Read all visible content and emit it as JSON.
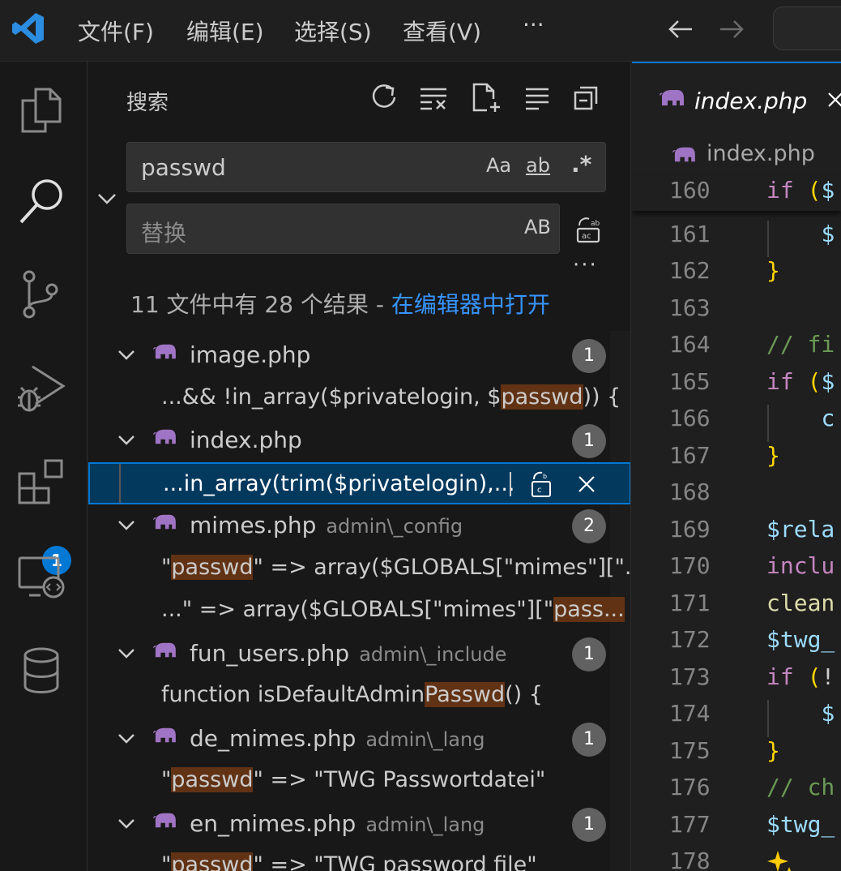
{
  "menu": {
    "file": "文件(F)",
    "edit": "编辑(E)",
    "selection": "选择(S)",
    "view": "查看(V)",
    "more": "···"
  },
  "activity_bar": {
    "icons": [
      "explorer-icon",
      "search-icon",
      "source-control-icon",
      "run-debug-icon",
      "extensions-icon",
      "remote-explorer-icon",
      "database-icon"
    ],
    "extensions_badge": "1",
    "accent": "#0078d4"
  },
  "search_view": {
    "title": "搜索",
    "search": {
      "value": "passwd",
      "match_case": "Aa",
      "whole_word": "ab",
      "regex": ".*"
    },
    "replace": {
      "placeholder": "替换",
      "preserve_case": "AB"
    },
    "more": "···",
    "summary": "11 文件中有 28 个结果 - ",
    "summary_link": "在编辑器中打开",
    "results": [
      {
        "file": "image.php",
        "path": "",
        "count": "1",
        "matches": [
          {
            "pre": "...&& !in_array($privatelogin, $",
            "hl": "passwd",
            "post": ")) {"
          }
        ]
      },
      {
        "file": "index.php",
        "path": "",
        "count": "1",
        "matches": [
          {
            "pre": "...in_array(trim($privatelogin),...",
            "hl": "",
            "post": ""
          }
        ]
      },
      {
        "file": "mimes.php",
        "path": "admin\\_config",
        "count": "2",
        "matches": [
          {
            "pre": "\"",
            "hl": "passwd",
            "post": "\" => array($GLOBALS[\"mimes\"][\"..."
          },
          {
            "pre": "...\"    => array($GLOBALS[\"mimes\"][\"",
            "hl": "pass...",
            "post": ""
          }
        ]
      },
      {
        "file": "fun_users.php",
        "path": "admin\\_include",
        "count": "1",
        "matches": [
          {
            "pre": "function isDefaultAdmin",
            "hl": "Passwd",
            "post": "() {"
          }
        ]
      },
      {
        "file": "de_mimes.php",
        "path": "admin\\_lang",
        "count": "1",
        "matches": [
          {
            "pre": "\"",
            "hl": "passwd",
            "post": "\" => \"TWG Passwortdatei\""
          }
        ]
      },
      {
        "file": "en_mimes.php",
        "path": "admin\\_lang",
        "count": "1",
        "matches": [
          {
            "pre": "\"",
            "hl": "passwd",
            "post": "\" => \"TWG password file\""
          }
        ]
      }
    ]
  },
  "editor": {
    "tab_label": "index.php",
    "breadcrumb": "index.php",
    "lines": [
      {
        "n": "160",
        "parts": [
          [
            "kw",
            "if"
          ],
          [
            "pl",
            " "
          ],
          [
            "br1",
            "("
          ],
          [
            "var",
            "$"
          ]
        ]
      },
      {
        "n": "161",
        "parts": [
          [
            "pl",
            "    "
          ],
          [
            "var",
            "$"
          ]
        ]
      },
      {
        "n": "162",
        "parts": [
          [
            "br1",
            "}"
          ]
        ]
      },
      {
        "n": "163",
        "parts": []
      },
      {
        "n": "164",
        "parts": [
          [
            "cmt",
            "// fi"
          ]
        ]
      },
      {
        "n": "165",
        "parts": [
          [
            "kw",
            "if"
          ],
          [
            "pl",
            " "
          ],
          [
            "br1",
            "("
          ],
          [
            "var",
            "$"
          ]
        ]
      },
      {
        "n": "166",
        "parts": [
          [
            "pl",
            "    "
          ],
          [
            "var",
            "c"
          ]
        ]
      },
      {
        "n": "167",
        "parts": [
          [
            "br1",
            "}"
          ]
        ]
      },
      {
        "n": "168",
        "parts": []
      },
      {
        "n": "169",
        "parts": [
          [
            "var",
            "$rela"
          ]
        ]
      },
      {
        "n": "170",
        "parts": [
          [
            "kw",
            "inclu"
          ]
        ]
      },
      {
        "n": "171",
        "parts": [
          [
            "fn",
            "clean"
          ]
        ]
      },
      {
        "n": "172",
        "parts": [
          [
            "var",
            "$twg_"
          ]
        ]
      },
      {
        "n": "173",
        "parts": [
          [
            "kw",
            "if"
          ],
          [
            "pl",
            " "
          ],
          [
            "br1",
            "("
          ],
          [
            "pl",
            "!"
          ]
        ]
      },
      {
        "n": "174",
        "parts": [
          [
            "pl",
            "    "
          ],
          [
            "var",
            "$"
          ]
        ]
      },
      {
        "n": "175",
        "parts": [
          [
            "br1",
            "}"
          ]
        ]
      },
      {
        "n": "176",
        "parts": [
          [
            "cmt",
            "// ch"
          ]
        ]
      },
      {
        "n": "177",
        "parts": [
          [
            "var",
            "$twg_"
          ]
        ]
      },
      {
        "n": "178",
        "parts": []
      }
    ]
  }
}
